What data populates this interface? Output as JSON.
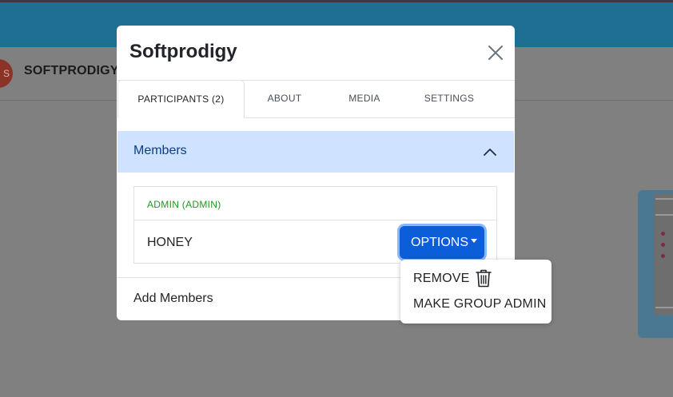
{
  "background": {
    "avatar_initial": "S",
    "chat_name": "SOFTPRODIGY"
  },
  "modal": {
    "title": "Softprodigy",
    "tabs": [
      {
        "label": "PARTICIPANTS (2)",
        "active": true
      },
      {
        "label": "ABOUT",
        "active": false
      },
      {
        "label": "MEDIA",
        "active": false
      },
      {
        "label": "SETTINGS",
        "active": false
      }
    ],
    "members_section": {
      "title": "Members",
      "admin_label": "ADMIN (ADMIN)",
      "member_name": "HONEY",
      "options_label": "OPTIONS"
    },
    "add_members_label": "Add Members"
  },
  "dropdown": {
    "items": [
      {
        "label": "REMOVE",
        "icon": "trash-icon"
      },
      {
        "label": "MAKE GROUP ADMIN"
      }
    ]
  },
  "colors": {
    "accent": "#0b5ed7",
    "accordion_bg": "#cfe2ff",
    "admin_green": "#1c9a1c",
    "appbar": "#1f6f93"
  }
}
